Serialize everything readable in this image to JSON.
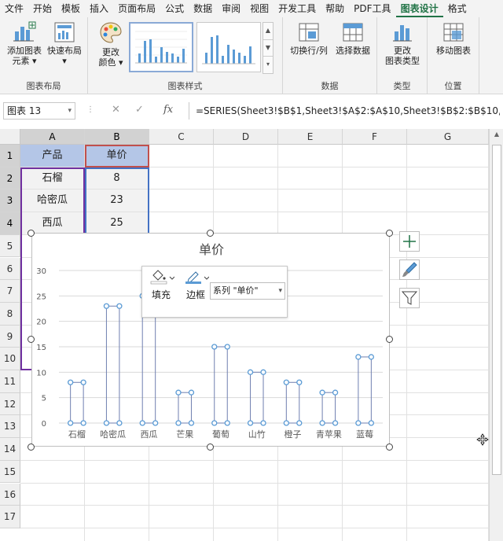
{
  "menu": {
    "tabs": [
      "文件",
      "开始",
      "模板",
      "插入",
      "页面布局",
      "公式",
      "数据",
      "审阅",
      "视图",
      "开发工具",
      "帮助",
      "PDF工具",
      "图表设计",
      "格式"
    ],
    "active_index": 12
  },
  "ribbon": {
    "layout_group": {
      "label": "图表布局",
      "add_element_line1": "添加图表",
      "add_element_line2": "元素",
      "quick_layout": "快速布局"
    },
    "style_group": {
      "label": "图表样式",
      "change_colors_line1": "更改",
      "change_colors_line2": "颜色"
    },
    "data_group": {
      "label": "数据",
      "switch_row_col": "切换行/列",
      "select_data": "选择数据"
    },
    "type_group": {
      "label": "类型",
      "change_type_line1": "更改",
      "change_type_line2": "图表类型"
    },
    "location_group": {
      "label": "位置",
      "move_chart": "移动图表"
    }
  },
  "formula_bar": {
    "name_box": "图表 13",
    "formula": "=SERIES(Sheet3!$B$1,Sheet3!$A$2:$A$10,Sheet3!$B$2:$B$10,"
  },
  "sheet": {
    "columns": [
      "A",
      "B",
      "C",
      "D",
      "E",
      "F",
      "G"
    ],
    "rows": [
      "1",
      "2",
      "3",
      "4",
      "5",
      "6",
      "7",
      "8",
      "9",
      "10",
      "11",
      "12",
      "13",
      "14",
      "15",
      "16",
      "17"
    ],
    "header_cells": [
      "产品",
      "单价"
    ],
    "data_rows": [
      [
        "石榴",
        "8"
      ],
      [
        "哈密瓜",
        "23"
      ],
      [
        "西瓜",
        "25"
      ]
    ]
  },
  "popup": {
    "fill_label": "填充",
    "outline_label": "边框",
    "series_select": "系列 \"单价\""
  },
  "colors": {
    "accent_green": "#217346",
    "series_blue": "#5b9bd5",
    "header_fill": "#b4c6e7"
  },
  "chart_data": {
    "type": "bar",
    "title": "单价",
    "categories": [
      "石榴",
      "哈密瓜",
      "西瓜",
      "芒果",
      "葡萄",
      "山竹",
      "橙子",
      "青苹果",
      "蓝莓"
    ],
    "series": [
      {
        "values": [
          8,
          23,
          25,
          6,
          15,
          10,
          8,
          6,
          13
        ]
      }
    ],
    "ylim": [
      0,
      30
    ],
    "yticks": [
      "0",
      "5",
      "10",
      "15",
      "20",
      "25",
      "30"
    ],
    "grid": true,
    "legend": "none",
    "fill": "none"
  }
}
